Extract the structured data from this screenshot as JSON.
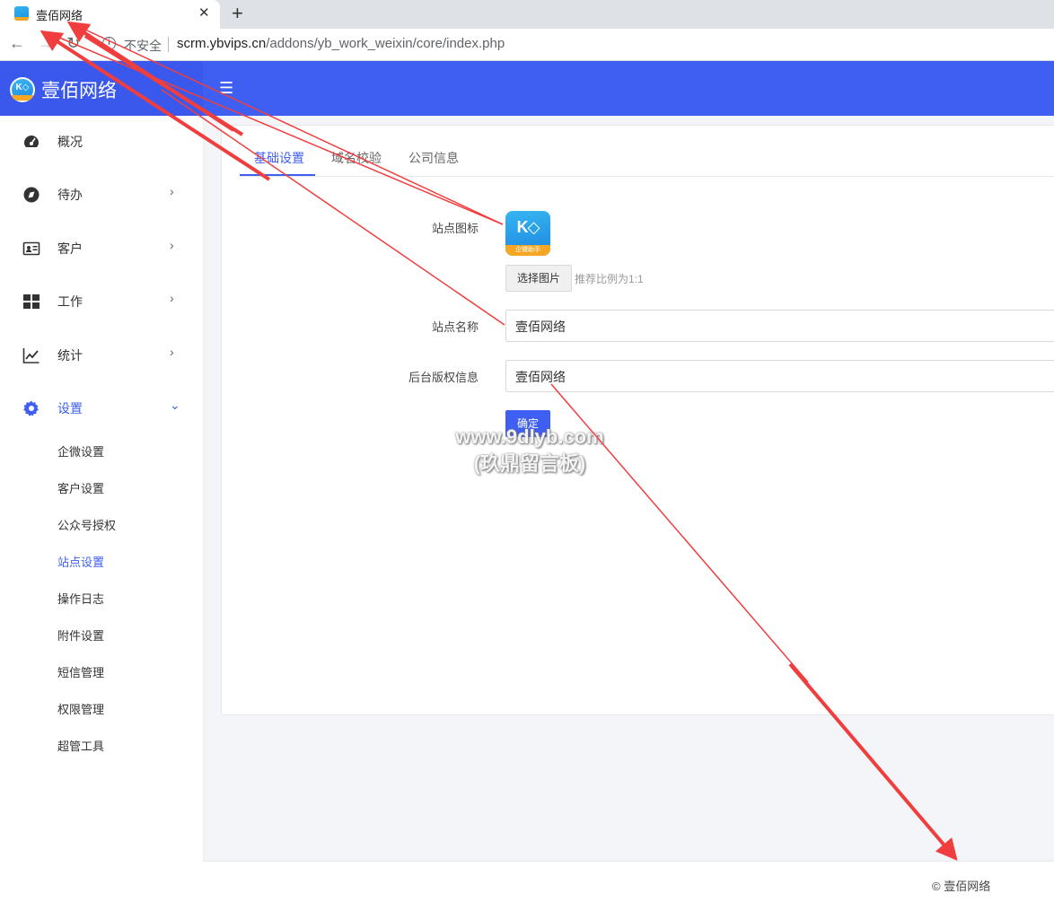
{
  "browser": {
    "tab_title": "壹佰网络",
    "tab_close": "✕",
    "new_tab": "+",
    "back": "←",
    "forward": "→",
    "reload": "↻",
    "security_text": "不安全",
    "url_host": "scrm.ybvips.cn",
    "url_path": "/addons/yb_work_weixin/core/index.php"
  },
  "header": {
    "brand_name": "壹佰网络",
    "logo_text": "K◇",
    "menu_icon": "☰"
  },
  "sidebar": {
    "items": [
      {
        "label": "概况",
        "icon": "dashboard-icon",
        "arrow": ""
      },
      {
        "label": "待办",
        "icon": "compass-icon",
        "arrow": "›"
      },
      {
        "label": "客户",
        "icon": "id-card-icon",
        "arrow": "›"
      },
      {
        "label": "工作",
        "icon": "grid-icon",
        "arrow": "›"
      },
      {
        "label": "统计",
        "icon": "chart-line-icon",
        "arrow": "›"
      },
      {
        "label": "设置",
        "icon": "gear-icon",
        "arrow": "⌄"
      }
    ],
    "sub_items": [
      "企微设置",
      "客户设置",
      "公众号授权",
      "站点设置",
      "操作日志",
      "附件设置",
      "短信管理",
      "权限管理",
      "超管工具"
    ],
    "active_sub": "站点设置"
  },
  "content": {
    "tabs": [
      "基础设置",
      "域名校验",
      "公司信息"
    ],
    "form": {
      "icon_label": "站点图标",
      "icon_logo_text": "K◇",
      "icon_band_text": "企微助手",
      "choose_button": "选择图片",
      "ratio_hint": "推荐比例为1:1",
      "name_label": "站点名称",
      "name_value": "壹佰网络",
      "copyright_label": "后台版权信息",
      "copyright_value": "壹佰网络",
      "submit": "确定"
    }
  },
  "footer": {
    "text": "© 壹佰网络"
  },
  "watermark": {
    "line1": "www.9dlyb.com",
    "line2": "(玖鼎留言板)"
  },
  "colors": {
    "primary": "#3f5ff3",
    "arrow": "#f03e3e"
  }
}
